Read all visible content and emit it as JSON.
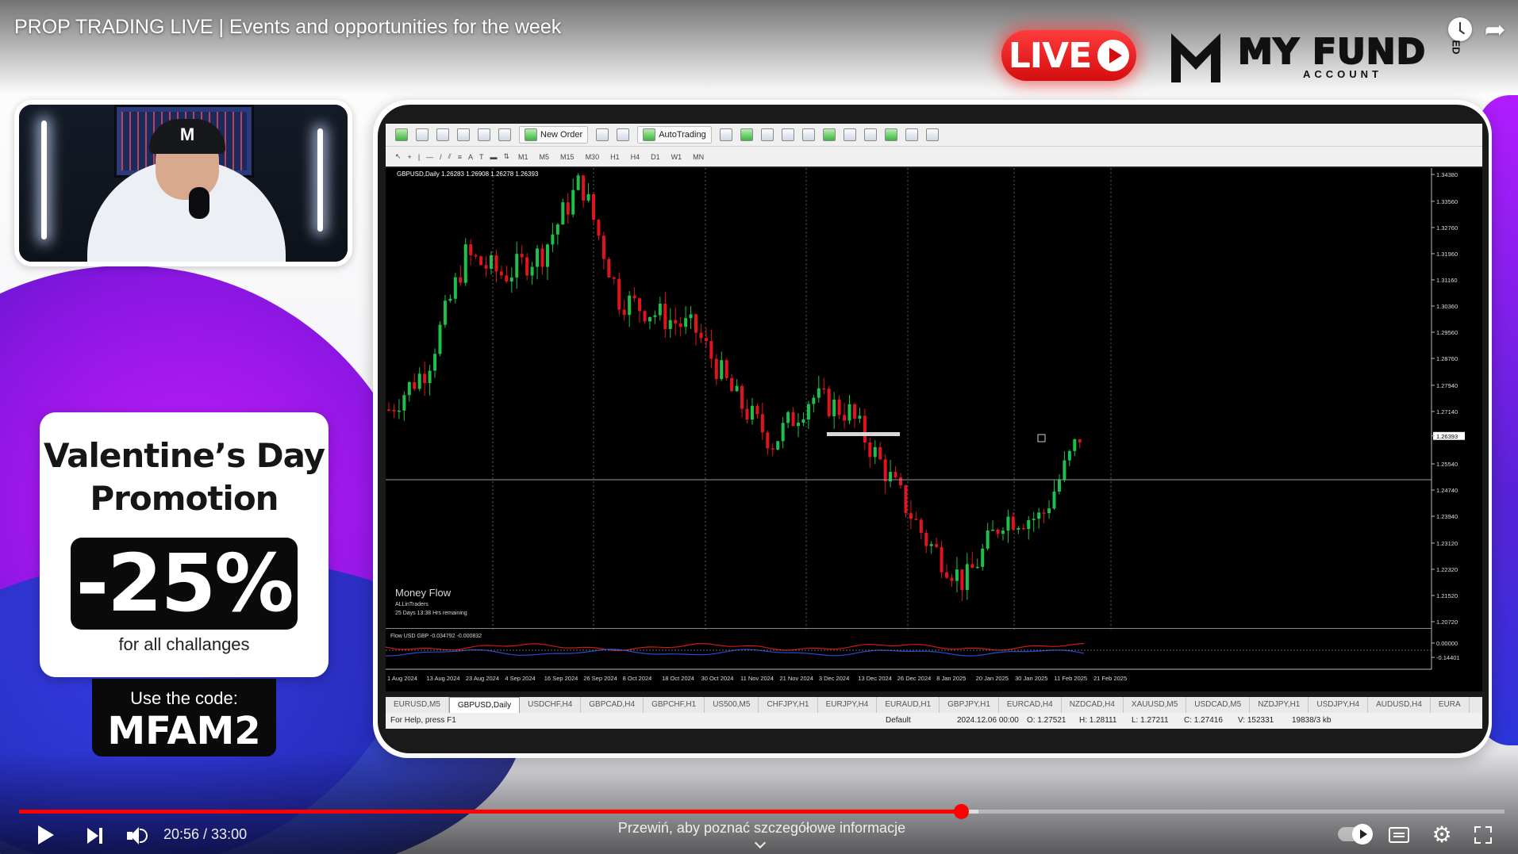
{
  "video": {
    "title": "PROP TRADING LIVE | Events and opportunities for the week"
  },
  "overlay": {
    "live_label": "LIVE",
    "brand_name": "MY FUND",
    "brand_suffix": "ED",
    "brand_sub": "ACCOUNT",
    "cam_cap_logo": "M",
    "colors": {
      "live_red": "#d40e0e",
      "accent_purple": "#8a16e0",
      "accent_blue": "#2a3fe0"
    }
  },
  "promo": {
    "title_line1": "Valentine’s Day",
    "title_line2": "Promotion",
    "discount": "-25%",
    "subtitle": "for all challanges",
    "code_label": "Use the code:",
    "code_value": "MFAM2"
  },
  "mt4": {
    "toolbar": {
      "new_order": "New Order",
      "auto_trading": "AutoTrading",
      "timeframes": [
        "M1",
        "M5",
        "M15",
        "M30",
        "H1",
        "H4",
        "D1",
        "W1",
        "MN"
      ]
    },
    "chart_header": "GBPUSD,Daily  1.26283 1.26908 1.26278 1.26393",
    "indicator": {
      "name": "Money Flow",
      "by": "ALLinTraders",
      "remaining": "25 Days 13:38 Hrs remaining",
      "subwindow_label": "Flow   USD GBP   -0.034792 -0.000832"
    },
    "price_axis": [
      "1.34380",
      "1.33560",
      "1.32760",
      "1.31960",
      "1.31160",
      "1.30360",
      "1.29560",
      "1.28760",
      "1.27940",
      "1.27140",
      "1.26393",
      "1.25540",
      "1.24740",
      "1.23940",
      "1.23120",
      "1.22320",
      "1.21520",
      "1.20720",
      "0.00000",
      "-0.14401"
    ],
    "date_axis": [
      "1 Aug 2024",
      "13 Aug 2024",
      "23 Aug 2024",
      "4 Sep 2024",
      "16 Sep 2024",
      "26 Sep 2024",
      "8 Oct 2024",
      "18 Oct 2024",
      "30 Oct 2024",
      "11 Nov 2024",
      "21 Nov 2024",
      "3 Dec 2024",
      "13 Dec 2024",
      "26 Dec 2024",
      "8 Jan 2025",
      "20 Jan 2025",
      "30 Jan 2025",
      "11 Feb 2025",
      "21 Feb 2025"
    ],
    "tabs": [
      "EURUSD,M5",
      "GBPUSD,Daily",
      "USDCHF,H4",
      "GBPCAD,H4",
      "GBPCHF,H1",
      "US500,M5",
      "CHFJPY,H1",
      "EURJPY,H4",
      "EURAUD,H1",
      "GBPJPY,H1",
      "EURCAD,H4",
      "NZDCAD,H4",
      "XAUUSD,M5",
      "USDCAD,M5",
      "NZDJPY,H1",
      "USDJPY,H4",
      "AUDUSD,H4",
      "EURA"
    ],
    "active_tab_index": 1,
    "status": {
      "help": "For Help, press F1",
      "profile": "Default",
      "datetime": "2024.12.06 00:00",
      "open": "O: 1.27521",
      "high": "H: 1.28111",
      "low": "L: 1.27211",
      "close": "C: 1.27416",
      "volume": "V: 152331",
      "traffic": "19838/3 kb"
    },
    "colors": {
      "bull": "#1fbf4b",
      "bear": "#e0141e",
      "background": "#000000"
    }
  },
  "player": {
    "current_time": "20:56",
    "duration": "33:00",
    "time_display": "20:56 / 33:00",
    "seek_hint": "Przewiń, aby poznać szczegółowe informacje",
    "played_fraction": 0.634,
    "buffered_fraction": 0.646
  },
  "chart_data": {
    "type": "candlestick",
    "title": "GBPUSD,Daily",
    "ylim": [
      1.2072,
      1.3438
    ],
    "x": [
      "1 Aug 2024",
      "13 Aug 2024",
      "23 Aug 2024",
      "4 Sep 2024",
      "16 Sep 2024",
      "26 Sep 2024",
      "8 Oct 2024",
      "18 Oct 2024",
      "30 Oct 2024",
      "11 Nov 2024",
      "21 Nov 2024",
      "3 Dec 2024",
      "13 Dec 2024",
      "26 Dec 2024",
      "8 Jan 2025",
      "20 Jan 2025",
      "30 Jan 2025",
      "11 Feb 2025",
      "21 Feb 2025"
    ],
    "close": [
      1.272,
      1.285,
      1.319,
      1.313,
      1.32,
      1.342,
      1.306,
      1.301,
      1.296,
      1.276,
      1.262,
      1.276,
      1.271,
      1.252,
      1.232,
      1.219,
      1.239,
      1.239,
      1.2639
    ],
    "last_price": 1.26393,
    "grid": false,
    "legend": "none"
  }
}
